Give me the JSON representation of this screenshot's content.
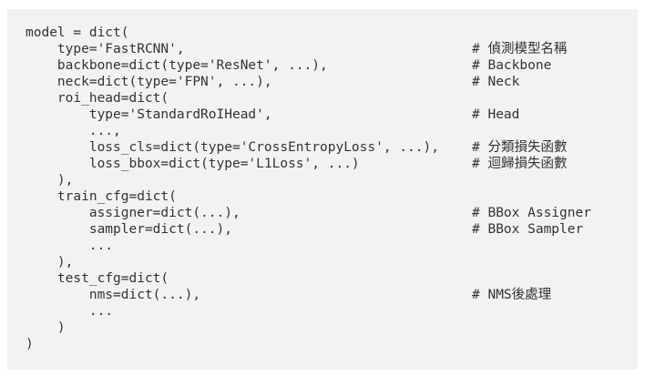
{
  "code_block": {
    "lines": [
      {
        "code": "model = dict(",
        "comment": ""
      },
      {
        "code": "    type='FastRCNN',",
        "comment": "# 偵測模型名稱"
      },
      {
        "code": "    backbone=dict(type='ResNet', ...),",
        "comment": "# Backbone"
      },
      {
        "code": "    neck=dict(type='FPN', ...),",
        "comment": "# Neck"
      },
      {
        "code": "    roi_head=dict(",
        "comment": ""
      },
      {
        "code": "        type='StandardRoIHead',",
        "comment": "# Head"
      },
      {
        "code": "        ...,",
        "comment": ""
      },
      {
        "code": "        loss_cls=dict(type='CrossEntropyLoss', ...),",
        "comment": "# 分類損失函數"
      },
      {
        "code": "        loss_bbox=dict(type='L1Loss', ...)",
        "comment": "# 迴歸損失函數"
      },
      {
        "code": "    ),",
        "comment": ""
      },
      {
        "code": "    train_cfg=dict(",
        "comment": ""
      },
      {
        "code": "        assigner=dict(...),",
        "comment": "# BBox Assigner"
      },
      {
        "code": "        sampler=dict(...),",
        "comment": "# BBox Sampler"
      },
      {
        "code": "        ...",
        "comment": ""
      },
      {
        "code": "    ),",
        "comment": ""
      },
      {
        "code": "    test_cfg=dict(",
        "comment": ""
      },
      {
        "code": "        nms=dict(...),",
        "comment": "# NMS後處理"
      },
      {
        "code": "        ...",
        "comment": ""
      },
      {
        "code": "    )",
        "comment": ""
      },
      {
        "code": ")",
        "comment": ""
      }
    ]
  }
}
